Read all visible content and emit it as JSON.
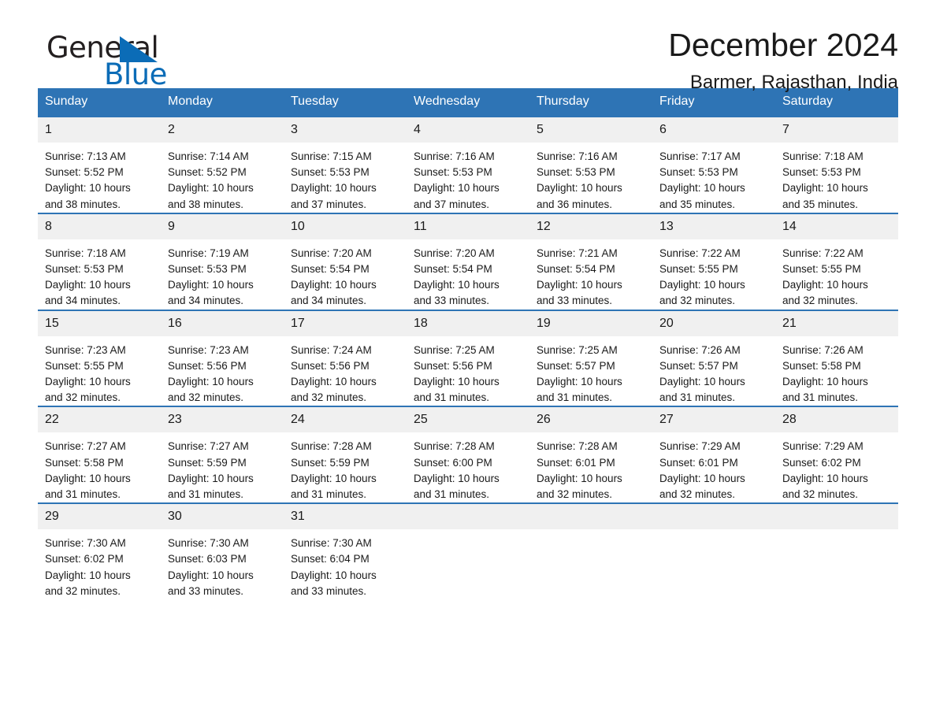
{
  "brand": {
    "name_part1": "General",
    "name_part2": "Blue",
    "logo_icon": "triangle-logo-icon",
    "accent_color": "#0b6cb7"
  },
  "header": {
    "title": "December 2024",
    "subtitle": "Barmer, Rajasthan, India"
  },
  "theme": {
    "header_blue": "#2e74b5",
    "daynum_bg": "#f0f0f0",
    "text": "#1a1a1a"
  },
  "weekdays": [
    "Sunday",
    "Monday",
    "Tuesday",
    "Wednesday",
    "Thursday",
    "Friday",
    "Saturday"
  ],
  "weeks": [
    [
      {
        "day": "1",
        "sunrise": "Sunrise: 7:13 AM",
        "sunset": "Sunset: 5:52 PM",
        "daylight_line1": "Daylight: 10 hours",
        "daylight_line2": "and 38 minutes."
      },
      {
        "day": "2",
        "sunrise": "Sunrise: 7:14 AM",
        "sunset": "Sunset: 5:52 PM",
        "daylight_line1": "Daylight: 10 hours",
        "daylight_line2": "and 38 minutes."
      },
      {
        "day": "3",
        "sunrise": "Sunrise: 7:15 AM",
        "sunset": "Sunset: 5:53 PM",
        "daylight_line1": "Daylight: 10 hours",
        "daylight_line2": "and 37 minutes."
      },
      {
        "day": "4",
        "sunrise": "Sunrise: 7:16 AM",
        "sunset": "Sunset: 5:53 PM",
        "daylight_line1": "Daylight: 10 hours",
        "daylight_line2": "and 37 minutes."
      },
      {
        "day": "5",
        "sunrise": "Sunrise: 7:16 AM",
        "sunset": "Sunset: 5:53 PM",
        "daylight_line1": "Daylight: 10 hours",
        "daylight_line2": "and 36 minutes."
      },
      {
        "day": "6",
        "sunrise": "Sunrise: 7:17 AM",
        "sunset": "Sunset: 5:53 PM",
        "daylight_line1": "Daylight: 10 hours",
        "daylight_line2": "and 35 minutes."
      },
      {
        "day": "7",
        "sunrise": "Sunrise: 7:18 AM",
        "sunset": "Sunset: 5:53 PM",
        "daylight_line1": "Daylight: 10 hours",
        "daylight_line2": "and 35 minutes."
      }
    ],
    [
      {
        "day": "8",
        "sunrise": "Sunrise: 7:18 AM",
        "sunset": "Sunset: 5:53 PM",
        "daylight_line1": "Daylight: 10 hours",
        "daylight_line2": "and 34 minutes."
      },
      {
        "day": "9",
        "sunrise": "Sunrise: 7:19 AM",
        "sunset": "Sunset: 5:53 PM",
        "daylight_line1": "Daylight: 10 hours",
        "daylight_line2": "and 34 minutes."
      },
      {
        "day": "10",
        "sunrise": "Sunrise: 7:20 AM",
        "sunset": "Sunset: 5:54 PM",
        "daylight_line1": "Daylight: 10 hours",
        "daylight_line2": "and 34 minutes."
      },
      {
        "day": "11",
        "sunrise": "Sunrise: 7:20 AM",
        "sunset": "Sunset: 5:54 PM",
        "daylight_line1": "Daylight: 10 hours",
        "daylight_line2": "and 33 minutes."
      },
      {
        "day": "12",
        "sunrise": "Sunrise: 7:21 AM",
        "sunset": "Sunset: 5:54 PM",
        "daylight_line1": "Daylight: 10 hours",
        "daylight_line2": "and 33 minutes."
      },
      {
        "day": "13",
        "sunrise": "Sunrise: 7:22 AM",
        "sunset": "Sunset: 5:55 PM",
        "daylight_line1": "Daylight: 10 hours",
        "daylight_line2": "and 32 minutes."
      },
      {
        "day": "14",
        "sunrise": "Sunrise: 7:22 AM",
        "sunset": "Sunset: 5:55 PM",
        "daylight_line1": "Daylight: 10 hours",
        "daylight_line2": "and 32 minutes."
      }
    ],
    [
      {
        "day": "15",
        "sunrise": "Sunrise: 7:23 AM",
        "sunset": "Sunset: 5:55 PM",
        "daylight_line1": "Daylight: 10 hours",
        "daylight_line2": "and 32 minutes."
      },
      {
        "day": "16",
        "sunrise": "Sunrise: 7:23 AM",
        "sunset": "Sunset: 5:56 PM",
        "daylight_line1": "Daylight: 10 hours",
        "daylight_line2": "and 32 minutes."
      },
      {
        "day": "17",
        "sunrise": "Sunrise: 7:24 AM",
        "sunset": "Sunset: 5:56 PM",
        "daylight_line1": "Daylight: 10 hours",
        "daylight_line2": "and 32 minutes."
      },
      {
        "day": "18",
        "sunrise": "Sunrise: 7:25 AM",
        "sunset": "Sunset: 5:56 PM",
        "daylight_line1": "Daylight: 10 hours",
        "daylight_line2": "and 31 minutes."
      },
      {
        "day": "19",
        "sunrise": "Sunrise: 7:25 AM",
        "sunset": "Sunset: 5:57 PM",
        "daylight_line1": "Daylight: 10 hours",
        "daylight_line2": "and 31 minutes."
      },
      {
        "day": "20",
        "sunrise": "Sunrise: 7:26 AM",
        "sunset": "Sunset: 5:57 PM",
        "daylight_line1": "Daylight: 10 hours",
        "daylight_line2": "and 31 minutes."
      },
      {
        "day": "21",
        "sunrise": "Sunrise: 7:26 AM",
        "sunset": "Sunset: 5:58 PM",
        "daylight_line1": "Daylight: 10 hours",
        "daylight_line2": "and 31 minutes."
      }
    ],
    [
      {
        "day": "22",
        "sunrise": "Sunrise: 7:27 AM",
        "sunset": "Sunset: 5:58 PM",
        "daylight_line1": "Daylight: 10 hours",
        "daylight_line2": "and 31 minutes."
      },
      {
        "day": "23",
        "sunrise": "Sunrise: 7:27 AM",
        "sunset": "Sunset: 5:59 PM",
        "daylight_line1": "Daylight: 10 hours",
        "daylight_line2": "and 31 minutes."
      },
      {
        "day": "24",
        "sunrise": "Sunrise: 7:28 AM",
        "sunset": "Sunset: 5:59 PM",
        "daylight_line1": "Daylight: 10 hours",
        "daylight_line2": "and 31 minutes."
      },
      {
        "day": "25",
        "sunrise": "Sunrise: 7:28 AM",
        "sunset": "Sunset: 6:00 PM",
        "daylight_line1": "Daylight: 10 hours",
        "daylight_line2": "and 31 minutes."
      },
      {
        "day": "26",
        "sunrise": "Sunrise: 7:28 AM",
        "sunset": "Sunset: 6:01 PM",
        "daylight_line1": "Daylight: 10 hours",
        "daylight_line2": "and 32 minutes."
      },
      {
        "day": "27",
        "sunrise": "Sunrise: 7:29 AM",
        "sunset": "Sunset: 6:01 PM",
        "daylight_line1": "Daylight: 10 hours",
        "daylight_line2": "and 32 minutes."
      },
      {
        "day": "28",
        "sunrise": "Sunrise: 7:29 AM",
        "sunset": "Sunset: 6:02 PM",
        "daylight_line1": "Daylight: 10 hours",
        "daylight_line2": "and 32 minutes."
      }
    ],
    [
      {
        "day": "29",
        "sunrise": "Sunrise: 7:30 AM",
        "sunset": "Sunset: 6:02 PM",
        "daylight_line1": "Daylight: 10 hours",
        "daylight_line2": "and 32 minutes."
      },
      {
        "day": "30",
        "sunrise": "Sunrise: 7:30 AM",
        "sunset": "Sunset: 6:03 PM",
        "daylight_line1": "Daylight: 10 hours",
        "daylight_line2": "and 33 minutes."
      },
      {
        "day": "31",
        "sunrise": "Sunrise: 7:30 AM",
        "sunset": "Sunset: 6:04 PM",
        "daylight_line1": "Daylight: 10 hours",
        "daylight_line2": "and 33 minutes."
      },
      {
        "day": "",
        "sunrise": "",
        "sunset": "",
        "daylight_line1": "",
        "daylight_line2": ""
      },
      {
        "day": "",
        "sunrise": "",
        "sunset": "",
        "daylight_line1": "",
        "daylight_line2": ""
      },
      {
        "day": "",
        "sunrise": "",
        "sunset": "",
        "daylight_line1": "",
        "daylight_line2": ""
      },
      {
        "day": "",
        "sunrise": "",
        "sunset": "",
        "daylight_line1": "",
        "daylight_line2": ""
      }
    ]
  ]
}
